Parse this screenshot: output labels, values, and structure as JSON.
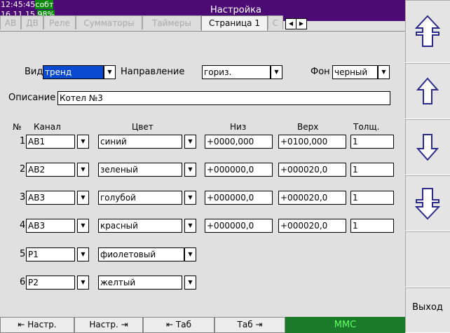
{
  "status": {
    "time": "12:45:45",
    "event": "собт",
    "date": "16.11.15",
    "battery": "98%"
  },
  "title": "Настройка",
  "tabs": [
    "АВ",
    "ДВ",
    "Реле",
    "Сумматоры",
    "Таймеры",
    "Страница 1",
    "С"
  ],
  "form": {
    "view_label": "Вид",
    "view_value": "тренд",
    "direction_label": "Направление",
    "direction_value": "гориз.",
    "bg_label": "Фон",
    "bg_value": "черный",
    "desc_label": "Описание",
    "desc_value": "Котел №3"
  },
  "columns": {
    "num": "№",
    "channel": "Канал",
    "color": "Цвет",
    "low": "Низ",
    "high": "Верх",
    "width": "Толщ."
  },
  "rows": [
    {
      "num": "1",
      "channel": "АВ1",
      "color": "синий",
      "low": "+0000,000",
      "high": "+0100,000",
      "width": "1"
    },
    {
      "num": "2",
      "channel": "АВ2",
      "color": "зеленый",
      "low": "+000000,0",
      "high": "+000020,0",
      "width": "1"
    },
    {
      "num": "3",
      "channel": "АВ3",
      "color": "голубой",
      "low": "+000000,0",
      "high": "+000020,0",
      "width": "1"
    },
    {
      "num": "4",
      "channel": "АВ3",
      "color": "красный",
      "low": "+000000,0",
      "high": "+000020,0",
      "width": "1"
    },
    {
      "num": "5",
      "channel": "Р1",
      "color": "фиолетовый"
    },
    {
      "num": "6",
      "channel": "Р2",
      "color": "желтый"
    }
  ],
  "right_panel": {
    "exit_label": "Выход"
  },
  "bottom": {
    "prev_setting": "⇤ Настр.",
    "next_setting": "Настр. ⇥",
    "prev_tab": "⇤ Таб",
    "next_tab": "Таб ⇥",
    "mmc": "MMC"
  },
  "colors": {
    "title_bg": "#4c0a74",
    "status_green": "#0a8a0a",
    "selected_blue": "#0a4ad0",
    "mmc_bg": "#1a7a2a",
    "mmc_text": "#60ff60"
  }
}
